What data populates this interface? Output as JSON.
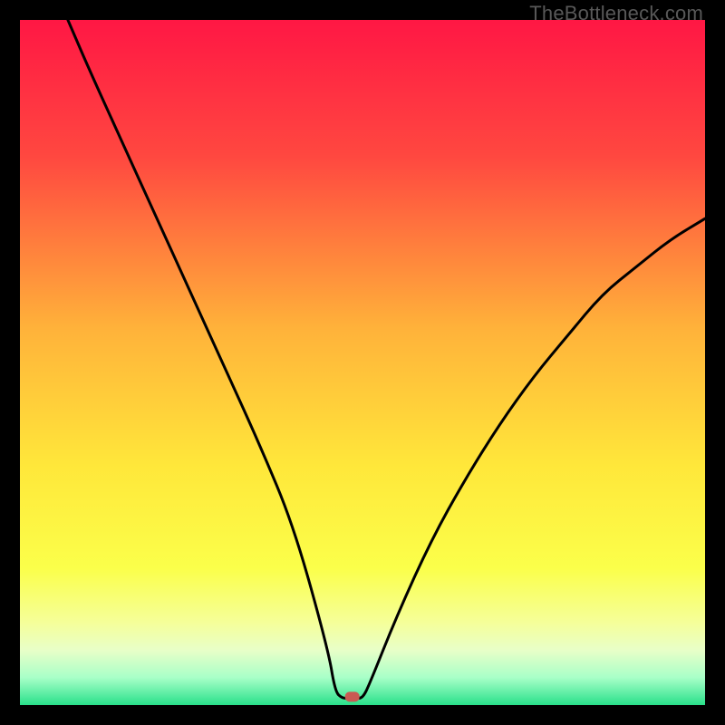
{
  "watermark": "TheBottleneck.com",
  "chart_data": {
    "type": "line",
    "title": "",
    "xlabel": "",
    "ylabel": "",
    "xlim": [
      0,
      100
    ],
    "ylim": [
      0,
      100
    ],
    "grid": false,
    "legend": false,
    "series": [
      {
        "name": "curve",
        "x": [
          7,
          10,
          15,
          20,
          25,
          30,
          35,
          40,
          45,
          46,
          47,
          48,
          49,
          50,
          51,
          55,
          60,
          65,
          70,
          75,
          80,
          85,
          90,
          95,
          100
        ],
        "y": [
          100,
          93,
          82,
          71,
          60,
          49,
          38,
          26,
          8,
          2,
          1,
          1,
          1,
          1,
          3,
          13,
          24,
          33,
          41,
          48,
          54,
          60,
          64,
          68,
          71
        ]
      }
    ],
    "marker": {
      "x": 48.5,
      "y": 1.2,
      "color": "#c95a52"
    },
    "background_gradient": {
      "stops": [
        {
          "pct": 0,
          "color": "#ff1744"
        },
        {
          "pct": 20,
          "color": "#ff4840"
        },
        {
          "pct": 45,
          "color": "#ffb23a"
        },
        {
          "pct": 65,
          "color": "#ffe73a"
        },
        {
          "pct": 80,
          "color": "#fbff4a"
        },
        {
          "pct": 88,
          "color": "#f5ff9a"
        },
        {
          "pct": 92,
          "color": "#e8ffc8"
        },
        {
          "pct": 96,
          "color": "#a8ffc8"
        },
        {
          "pct": 100,
          "color": "#29e08a"
        }
      ]
    }
  }
}
